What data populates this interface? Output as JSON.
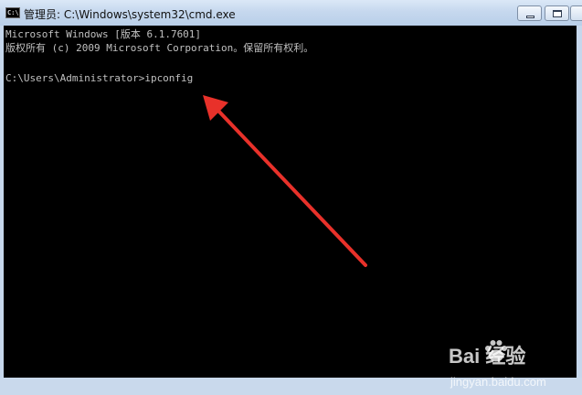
{
  "window": {
    "title": "管理员: C:\\Windows\\system32\\cmd.exe",
    "icon": "cmd-icon",
    "icon_label": "C:\\"
  },
  "console": {
    "lines": [
      "Microsoft Windows [版本 6.1.7601]",
      "版权所有 (c) 2009 Microsoft Corporation。保留所有权利。",
      "C:\\Users\\Administrator>ipconfig"
    ],
    "text_color": "#c0c0c0",
    "background": "#000000"
  },
  "annotation": {
    "arrow_color": "#e8312a"
  },
  "watermark": {
    "brand": "Bai  经验",
    "url": "jingyan.baidu.com"
  }
}
